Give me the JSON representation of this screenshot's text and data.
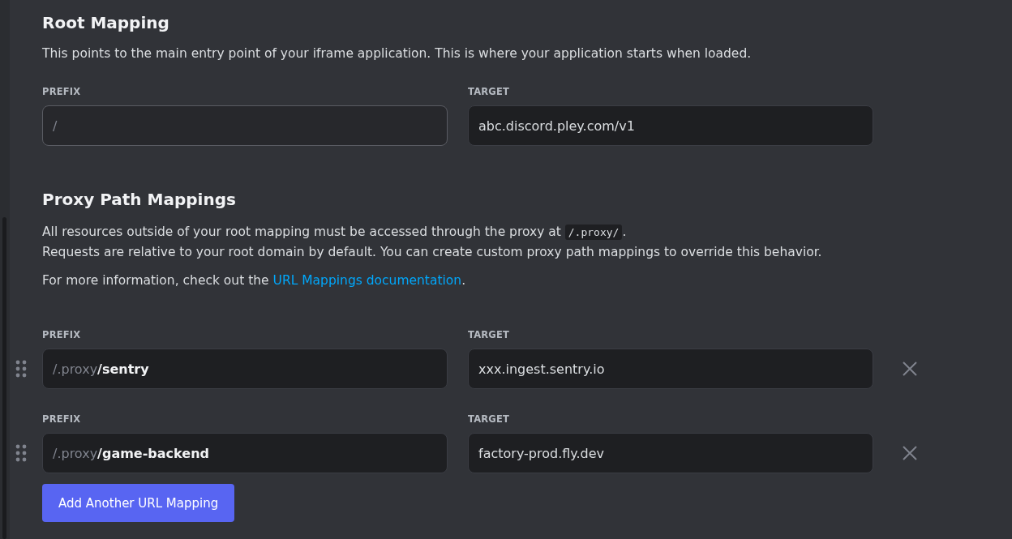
{
  "root_mapping": {
    "title": "Root Mapping",
    "description": "This points to the main entry point of your iframe application. This is where your application starts when loaded.",
    "prefix": {
      "label": "PREFIX",
      "value": "/",
      "disabled": true
    },
    "target": {
      "label": "TARGET",
      "value": "abc.discord.pley.com/v1"
    }
  },
  "proxy_mappings": {
    "title": "Proxy Path Mappings",
    "line_1": {
      "before": "All resources outside of your root mapping must be accessed through the proxy at",
      "code": "/.proxy/",
      "after": "."
    },
    "line_2": "Requests are relative to your root domain by default. You can create custom proxy path mappings to override this behavior.",
    "line_3": {
      "before": "For more information, check out the",
      "link": "URL Mappings documentation",
      "after": "."
    },
    "rows": [
      {
        "prefix_label": "PREFIX",
        "prefix_fixed": "/.proxy",
        "prefix_value": "/sentry",
        "target_label": "TARGET",
        "target_value": "xxx.ingest.sentry.io"
      },
      {
        "prefix_label": "PREFIX",
        "prefix_fixed": "/.proxy",
        "prefix_value": "/game-backend",
        "target_label": "TARGET",
        "target_value": "factory-prod.fly.dev"
      }
    ],
    "add_button": "Add Another URL Mapping"
  }
}
